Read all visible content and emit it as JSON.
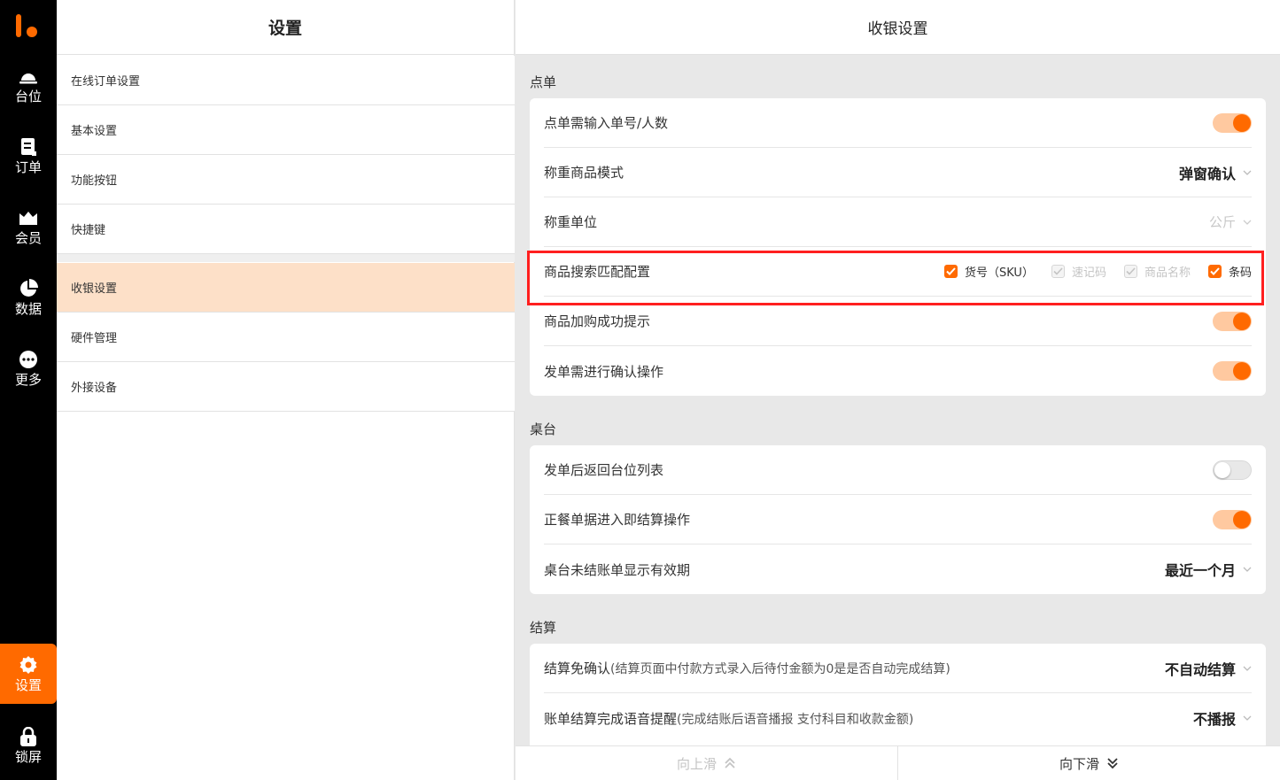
{
  "nav": {
    "items": [
      {
        "label": "台位",
        "icon": "table-bell-icon"
      },
      {
        "label": "订单",
        "icon": "order-icon"
      },
      {
        "label": "会员",
        "icon": "member-crown-icon"
      },
      {
        "label": "数据",
        "icon": "pie-chart-icon"
      },
      {
        "label": "更多",
        "icon": "more-dots-icon"
      },
      {
        "label": "设置",
        "icon": "gear-icon"
      },
      {
        "label": "锁屏",
        "icon": "lock-icon"
      }
    ],
    "active": "设置",
    "accent": "#ff6a00"
  },
  "menu": {
    "title": "设置",
    "items": [
      "在线订单设置",
      "基本设置",
      "功能按钮",
      "快捷键",
      "收银设置",
      "硬件管理",
      "外接设备"
    ],
    "active": "收银设置"
  },
  "panel": {
    "title": "收银设置",
    "sections": {
      "order": {
        "title": "点单",
        "rows": {
          "need_input": {
            "label": "点单需输入单号/人数",
            "toggle": "on"
          },
          "weigh_mode": {
            "label": "称重商品模式",
            "value": "弹窗确认"
          },
          "weigh_unit": {
            "label": "称重单位",
            "value": "公斤"
          },
          "search_match": {
            "label": "商品搜索匹配配置",
            "options": [
              {
                "label": "货号（SKU）",
                "state": "checked"
              },
              {
                "label": "速记码",
                "state": "disabled"
              },
              {
                "label": "商品名称",
                "state": "disabled"
              },
              {
                "label": "条码",
                "state": "checked"
              }
            ]
          },
          "add_tip": {
            "label": "商品加购成功提示",
            "toggle": "on"
          },
          "send_confirm": {
            "label": "发单需进行确认操作",
            "toggle": "on"
          }
        }
      },
      "table": {
        "title": "桌台",
        "rows": {
          "back_list": {
            "label": "发单后返回台位列表",
            "toggle": "off"
          },
          "settle_now": {
            "label": "正餐单据进入即结算操作",
            "toggle": "on"
          },
          "unpaid_period": {
            "label": "桌台未结账单显示有效期",
            "value": "最近一个月"
          }
        }
      },
      "settle": {
        "title": "结算",
        "rows": {
          "no_confirm": {
            "label": "结算免确认",
            "hint": "(结算页面中付款方式录入后待付金额为0是是否自动完成结算)",
            "value": "不自动结算"
          },
          "voice": {
            "label": "账单结算完成语音提醒",
            "hint": "(完成结账后语音播报 支付科目和收款金额)",
            "value": "不播报"
          }
        }
      }
    },
    "scroll": {
      "up": "向上滑",
      "down": "向下滑"
    }
  }
}
